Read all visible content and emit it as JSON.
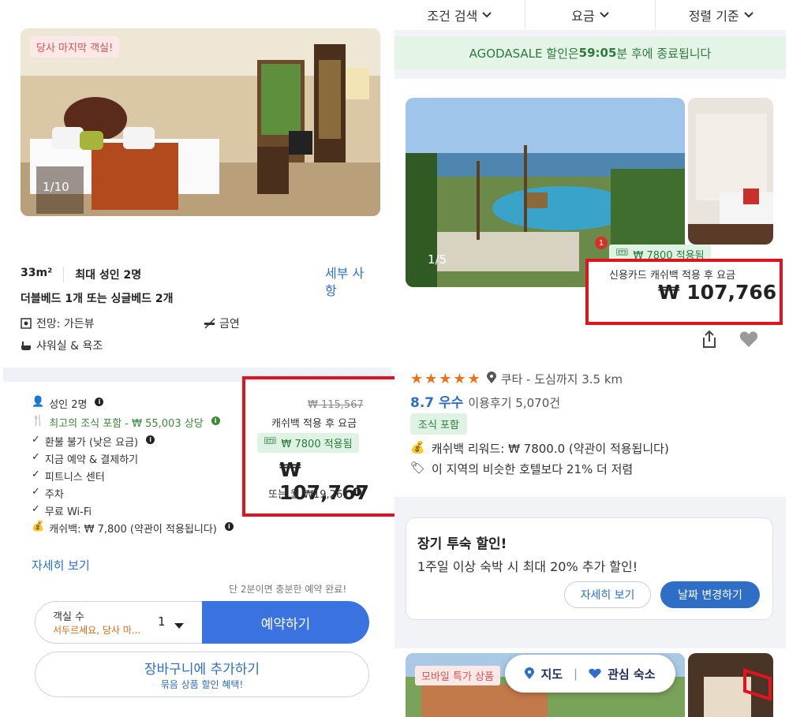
{
  "left": {
    "room": {
      "last_room_badge": "당사 마지막 객실!",
      "photo_counter": "1/10",
      "size": "33m²",
      "max_guests": "최대 성인 2명",
      "details_link": "세부 사항",
      "bed_type": "더블베드 1개 또는 싱글베드 2개",
      "view": "전망: 가든뷰",
      "smoking": "금연",
      "bathroom": "샤워실 & 욕조"
    },
    "offer": {
      "guests": "성인 2명",
      "breakfast": "최고의 조식 포함 - ₩ 55,003 상당",
      "refund": "환불 불가 (낮은 요금)",
      "pay_now": "지금 예약 & 결제하기",
      "fitness": "피트니스 센터",
      "parking": "주차",
      "wifi": "무료 Wi-Fi",
      "cashback": "캐쉬백: ₩ 7,800 (약관이 적용됩니다)",
      "more_link": "자세히 보기",
      "price_original": "₩ 115,567",
      "price_caption": "캐쉬백 적용 후 요금",
      "applied_badge": "₩ 7800 적용됨",
      "price_final": "₩ 107,767",
      "price_monthly": "또는 월 ₩19,261",
      "quick_note": "단 2분이면 충분한 예약 완료!",
      "rooms_label": "객실 수",
      "rooms_warning": "서두르세요, 당사 마...",
      "rooms_value": "1",
      "book_button": "예약하기",
      "cart_button": "장바구니에 추가하기",
      "cart_sub": "묶음 상품 할인 혜택!"
    }
  },
  "right": {
    "filters": [
      "조건 검색",
      "요금",
      "정렬 기준"
    ],
    "sale_banner_prefix": "AGODASALE 할인은 ",
    "sale_banner_time": "59:05",
    "sale_banner_suffix": "분 후에 종료됩니다",
    "hotel": {
      "photo_counter": "1/5",
      "notif_count": "1",
      "applied_badge": "₩ 7800 적용됨",
      "price_caption": "신용카드 캐쉬백 적용 후 요금",
      "price": "₩ 107,766",
      "location": "쿠타 - 도심까지 3.5 km",
      "rating_score": "8.7 우수",
      "reviews": "이용후기 5,070건",
      "breakfast_tag": "조식 포함",
      "cashback_reward": "캐쉬백 리워드: ₩ 7800.0 (약관이 적용됩니다)",
      "cheaper_note": "이 지역의 비슷한 호텔보다 21% 더 저렴"
    },
    "long_stay": {
      "title": "장기 투숙 할인!",
      "desc": "1주일 이상 숙박 시 최대 20% 추가 할인!",
      "more_button": "자세히 보기",
      "date_button": "날짜 변경하기"
    },
    "bottom": {
      "mobile_badge": "모바일 특가 상품",
      "map_button": "지도",
      "fav_button": "관심 숙소"
    }
  },
  "colors": {
    "accent_blue": "#3a72e0",
    "link_blue": "#2e6ec7",
    "highlight_red": "#e0141e",
    "green": "#2c7a3c",
    "star_orange": "#e8731c"
  }
}
